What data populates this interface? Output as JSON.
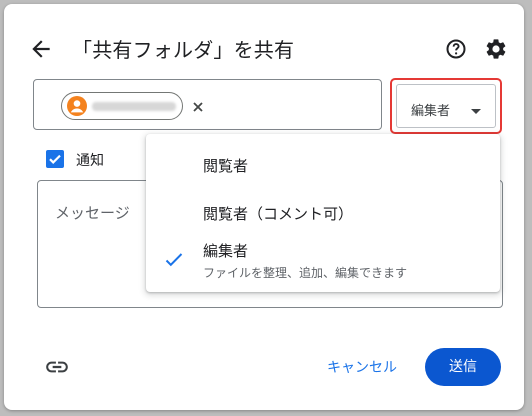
{
  "dialog": {
    "title": "「共有フォルダ」を共有"
  },
  "icons": {
    "back": "arrow-back-icon",
    "help": "help-circle-icon",
    "settings": "gear-icon",
    "chip_close": "close-circle-icon",
    "link": "link-icon",
    "checkmark": "check-icon"
  },
  "role_select": {
    "selected": "編集者"
  },
  "notify": {
    "label": "通知",
    "checked": true
  },
  "message": {
    "placeholder": "メッセージ"
  },
  "role_menu": {
    "items": [
      {
        "label": "閲覧者",
        "sub": "",
        "selected": false
      },
      {
        "label": "閲覧者（コメント可）",
        "sub": "",
        "selected": false
      },
      {
        "label": "編集者",
        "sub": "ファイルを整理、追加、編集できます",
        "selected": true
      }
    ]
  },
  "footer": {
    "cancel_label": "キャンセル",
    "send_label": "送信"
  },
  "colors": {
    "accent": "#1a73e8",
    "send_button": "#0b57d0",
    "highlight_outline": "#e53935",
    "avatar": "#f4821e"
  }
}
